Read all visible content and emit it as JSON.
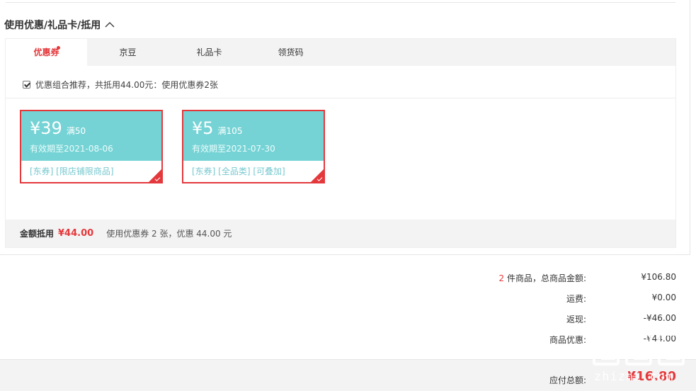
{
  "section_title": "使用优惠/礼品卡/抵用",
  "tabs": [
    {
      "label": "优惠券",
      "active": true,
      "has_dot": true
    },
    {
      "label": "京豆",
      "active": false
    },
    {
      "label": "礼品卡",
      "active": false
    },
    {
      "label": "领货码",
      "active": false
    }
  ],
  "combo": {
    "checked": true,
    "text": "优惠组合推荐，共抵用44.00元：使用优惠券2张"
  },
  "coupons": [
    {
      "amount": "¥39",
      "threshold": "满50",
      "valid": "有效期至2021-08-06",
      "tags": "[东券] [限店铺限商品]",
      "selected": true
    },
    {
      "amount": "¥5",
      "threshold": "满105",
      "valid": "有效期至2021-07-30",
      "tags": "[东券] [全品类] [可叠加]",
      "selected": true
    }
  ],
  "summary": {
    "label": "金额抵用",
    "amount": "¥44.00",
    "desc": "使用优惠券 2 张，优惠 44.00 元"
  },
  "totals": {
    "count": "2",
    "goods_label": "件商品，总商品金额:",
    "goods_value": "¥106.80",
    "shipping_label": "运费:",
    "shipping_value": "¥0.00",
    "cashback_label": "返现:",
    "cashback_value": "-¥46.00",
    "discount_label": "商品优惠:",
    "discount_value": "-¥44.00"
  },
  "pay": {
    "label": "应付总额:",
    "value": "¥16.80"
  },
  "watermark": {
    "text": "zhizhi.com"
  },
  "colors": {
    "accent": "#e4393c",
    "coupon_teal": "#76d3d5",
    "bar_gray": "#f3f3f3"
  }
}
